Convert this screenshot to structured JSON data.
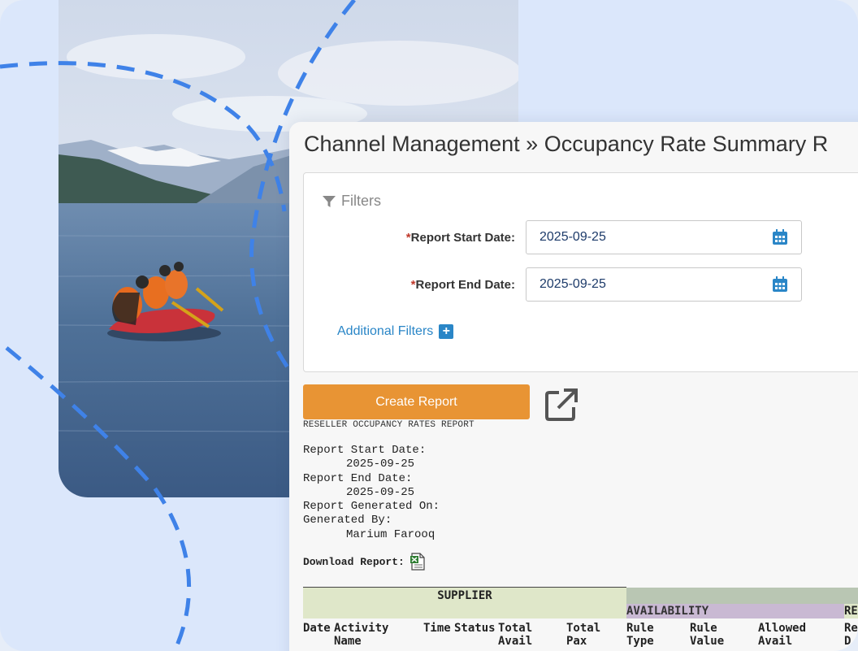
{
  "page": {
    "title": "Channel Management » Occupancy Rate Summary R"
  },
  "filters": {
    "heading": "Filters",
    "start_label": "Report Start Date:",
    "start_value": "2025-09-25",
    "end_label": "Report End Date:",
    "end_value": "2025-09-25",
    "required_mark": "*",
    "additional_label": "Additional Filters",
    "additional_icon": "+"
  },
  "actions": {
    "create_label": "Create Report"
  },
  "report": {
    "caption": "RESELLER OCCUPANCY RATES REPORT",
    "start_label": "Report Start Date:",
    "start_value": "2025-09-25",
    "end_label": "Report End Date:",
    "end_value": "2025-09-25",
    "generated_on_label": "Report Generated On:",
    "generated_by_label": "Generated By:",
    "generated_by_value": "Marium Farooq",
    "download_label": "Download Report:"
  },
  "table": {
    "group_supplier": "SUPPLIER",
    "group_availability": "AVAILABILITY",
    "group_re": "RE",
    "columns": [
      {
        "line1": "Date",
        "line2": ""
      },
      {
        "line1": "Activity",
        "line2": "Name"
      },
      {
        "line1": "Time",
        "line2": ""
      },
      {
        "line1": "Status",
        "line2": ""
      },
      {
        "line1": "Total",
        "line2": "Avail"
      },
      {
        "line1": "Total",
        "line2": "Pax"
      },
      {
        "line1": "Rule",
        "line2": "Type"
      },
      {
        "line1": "Rule",
        "line2": "Value"
      },
      {
        "line1": "Allowed",
        "line2": "Avail"
      },
      {
        "line1": "Re",
        "line2": "D"
      }
    ]
  },
  "colors": {
    "accent_orange": "#e89434",
    "link_blue": "#2a86c7",
    "dash_blue": "#3f82e8",
    "background": "#dbe7fb"
  }
}
